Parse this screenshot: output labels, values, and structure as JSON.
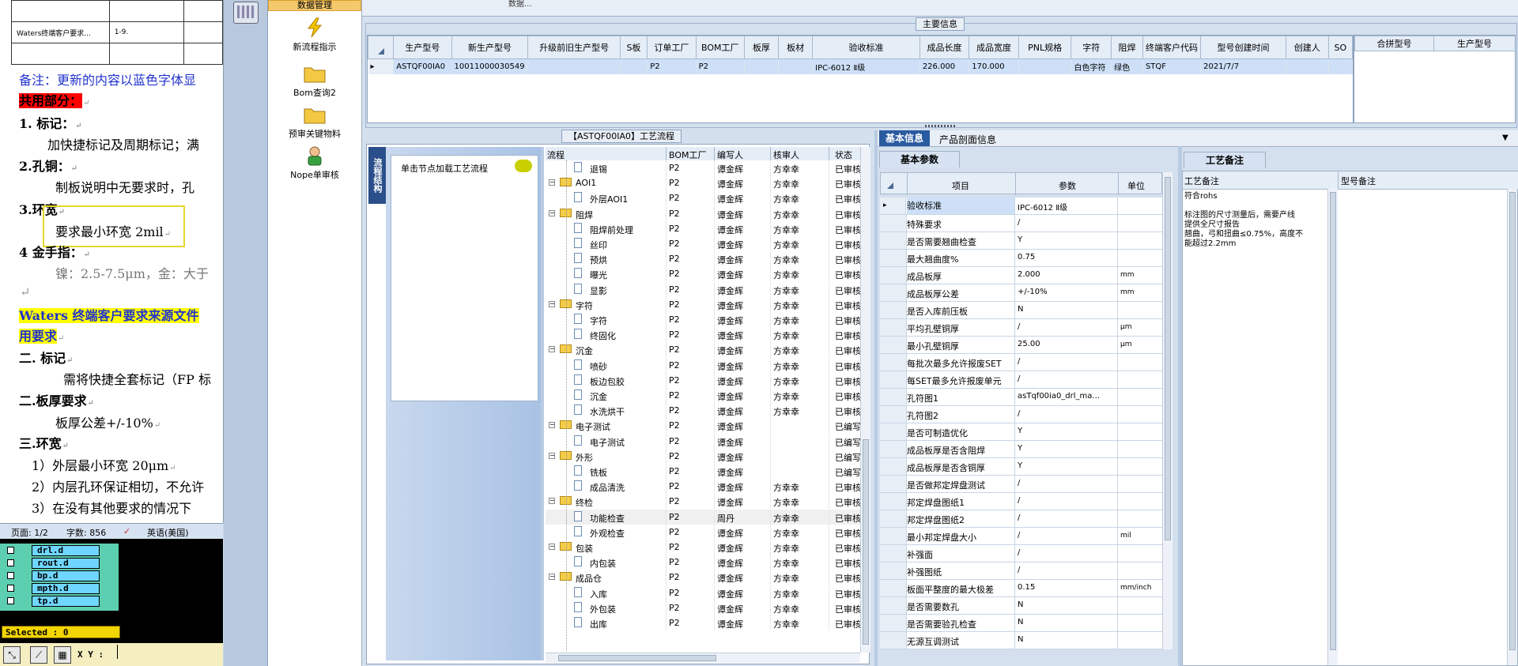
{
  "word": {
    "table_rows": [
      {
        "c1": "",
        "c2": "",
        "c3": ""
      },
      {
        "c1": "Waters终端客户要求...",
        "c2": "1-9.",
        "c3": ""
      },
      {
        "c1": "",
        "c2": "",
        "c3": ""
      }
    ],
    "lines": {
      "note": "备注：更新的内容以蓝色字体显",
      "common": "共用部分：",
      "h1": "1.    标记：",
      "p1": "加快捷标记及周期标记；满",
      "h2": "2.孔铜：",
      "p2": "制板说明中无要求时，孔",
      "h3": "3.环宽",
      "p3": "要求最小环宽 2mil",
      "h4": "4  金手指：",
      "p4": "镍：2.5-7.5μm，金：大于",
      "waters1": "Waters 终端客户要求来源文件",
      "waters2": "用要求",
      "h5": "二.  标记",
      "p5": "需将快捷全套标记（FP 标",
      "h6": "二.板厚要求",
      "p6": "板厚公差+/-10%",
      "h7": "三.环宽",
      "p7": "1）外层最小环宽 20μm",
      "p8": "2）内层孔环保证相切，不允许",
      "p9": "3）在没有其他要求的情况下"
    },
    "status": {
      "page": "页面: 1/2",
      "words": "字数: 856",
      "lang": "英语(美国)"
    }
  },
  "cam": {
    "layers": [
      "drl.d",
      "rout.d",
      "bp.d",
      "mpth.d",
      "tp.d"
    ],
    "selected": "Selected : 0",
    "xy": "X Y :"
  },
  "toolbar": {
    "data_mgmt": "数据管理",
    "items": [
      "新流程指示",
      "Bom查询2",
      "预审关键物料",
      "Nope单审核"
    ]
  },
  "main_info": {
    "title": "主要信息",
    "top_stub": "数据...",
    "headers": [
      "生产型号",
      "新生产型号",
      "升级前旧生产型号",
      "S板",
      "订单工厂",
      "BOM工厂",
      "板厚",
      "板材",
      "验收标准",
      "成品长度",
      "成品宽度",
      "PNL规格",
      "字符",
      "阻焊",
      "终端客户代码",
      "型号创建时间",
      "创建人",
      "SO"
    ],
    "row": [
      "ASTQF00IA0",
      "10011000030549",
      "",
      "",
      "P2",
      "P2",
      "",
      "",
      "IPC-6012 Ⅱ级",
      "226.000",
      "170.000",
      "",
      "白色字符",
      "绿色",
      "STQF",
      "2021/7/7",
      "",
      ""
    ],
    "merge_headers": [
      "合拼型号",
      "生产型号"
    ]
  },
  "process": {
    "title": "【ASTQF00IA0】工艺流程",
    "side_tab": "流程结构",
    "load_text": "单击节点加载工艺流程",
    "headers": [
      "流程",
      "BOM工厂",
      "编写人",
      "核审人",
      "状态"
    ],
    "rows": [
      {
        "name": "退锡",
        "level": 2,
        "type": "doc",
        "bom": "P2",
        "writer": "谭金辉",
        "reviewer": "方幸幸",
        "status": "已审核"
      },
      {
        "name": "AOI1",
        "level": 1,
        "type": "folder",
        "bom": "P2",
        "writer": "谭金辉",
        "reviewer": "方幸幸",
        "status": "已审核"
      },
      {
        "name": "外层AOI1",
        "level": 2,
        "type": "doc",
        "bom": "P2",
        "writer": "谭金辉",
        "reviewer": "方幸幸",
        "status": "已审核"
      },
      {
        "name": "阻焊",
        "level": 1,
        "type": "folder",
        "bom": "P2",
        "writer": "谭金辉",
        "reviewer": "方幸幸",
        "status": "已审核"
      },
      {
        "name": "阻焊前处理",
        "level": 2,
        "type": "doc",
        "bom": "P2",
        "writer": "谭金辉",
        "reviewer": "方幸幸",
        "status": "已审核"
      },
      {
        "name": "丝印",
        "level": 2,
        "type": "doc",
        "bom": "P2",
        "writer": "谭金辉",
        "reviewer": "方幸幸",
        "status": "已审核"
      },
      {
        "name": "预烘",
        "level": 2,
        "type": "doc",
        "bom": "P2",
        "writer": "谭金辉",
        "reviewer": "方幸幸",
        "status": "已审核"
      },
      {
        "name": "曝光",
        "level": 2,
        "type": "doc",
        "bom": "P2",
        "writer": "谭金辉",
        "reviewer": "方幸幸",
        "status": "已审核"
      },
      {
        "name": "显影",
        "level": 2,
        "type": "doc",
        "bom": "P2",
        "writer": "谭金辉",
        "reviewer": "方幸幸",
        "status": "已审核"
      },
      {
        "name": "字符",
        "level": 1,
        "type": "folder",
        "bom": "P2",
        "writer": "谭金辉",
        "reviewer": "方幸幸",
        "status": "已审核"
      },
      {
        "name": "字符",
        "level": 2,
        "type": "doc",
        "bom": "P2",
        "writer": "谭金辉",
        "reviewer": "方幸幸",
        "status": "已审核"
      },
      {
        "name": "终固化",
        "level": 2,
        "type": "doc",
        "bom": "P2",
        "writer": "谭金辉",
        "reviewer": "方幸幸",
        "status": "已审核"
      },
      {
        "name": "沉金",
        "level": 1,
        "type": "folder",
        "bom": "P2",
        "writer": "谭金辉",
        "reviewer": "方幸幸",
        "status": "已审核"
      },
      {
        "name": "喷砂",
        "level": 2,
        "type": "doc",
        "bom": "P2",
        "writer": "谭金辉",
        "reviewer": "方幸幸",
        "status": "已审核"
      },
      {
        "name": "板边包胶",
        "level": 2,
        "type": "doc",
        "bom": "P2",
        "writer": "谭金辉",
        "reviewer": "方幸幸",
        "status": "已审核"
      },
      {
        "name": "沉金",
        "level": 2,
        "type": "doc",
        "bom": "P2",
        "writer": "谭金辉",
        "reviewer": "方幸幸",
        "status": "已审核"
      },
      {
        "name": "水洗烘干",
        "level": 2,
        "type": "doc",
        "bom": "P2",
        "writer": "谭金辉",
        "reviewer": "方幸幸",
        "status": "已审核"
      },
      {
        "name": "电子测试",
        "level": 1,
        "type": "folder",
        "bom": "P2",
        "writer": "谭金辉",
        "reviewer": "",
        "status": "已编写"
      },
      {
        "name": "电子测试",
        "level": 2,
        "type": "doc",
        "bom": "P2",
        "writer": "谭金辉",
        "reviewer": "",
        "status": "已编写"
      },
      {
        "name": "外形",
        "level": 1,
        "type": "folder",
        "bom": "P2",
        "writer": "谭金辉",
        "reviewer": "",
        "status": "已编写"
      },
      {
        "name": "铣板",
        "level": 2,
        "type": "doc",
        "bom": "P2",
        "writer": "谭金辉",
        "reviewer": "",
        "status": "已编写"
      },
      {
        "name": "成品清洗",
        "level": 2,
        "type": "doc",
        "bom": "P2",
        "writer": "谭金辉",
        "reviewer": "方幸幸",
        "status": "已审核"
      },
      {
        "name": "终检",
        "level": 1,
        "type": "folder",
        "bom": "P2",
        "writer": "谭金辉",
        "reviewer": "方幸幸",
        "status": "已审核"
      },
      {
        "name": "功能检查",
        "level": 2,
        "type": "doc",
        "bom": "P2",
        "writer": "周丹",
        "reviewer": "方幸幸",
        "status": "已审核"
      },
      {
        "name": "外观检查",
        "level": 2,
        "type": "doc",
        "bom": "P2",
        "writer": "谭金辉",
        "reviewer": "方幸幸",
        "status": "已审核"
      },
      {
        "name": "包装",
        "level": 1,
        "type": "folder",
        "bom": "P2",
        "writer": "谭金辉",
        "reviewer": "方幸幸",
        "status": "已审核"
      },
      {
        "name": "内包装",
        "level": 2,
        "type": "doc",
        "bom": "P2",
        "writer": "谭金辉",
        "reviewer": "方幸幸",
        "status": "已审核"
      },
      {
        "name": "成品仓",
        "level": 1,
        "type": "folder",
        "bom": "P2",
        "writer": "谭金辉",
        "reviewer": "方幸幸",
        "status": "已审核"
      },
      {
        "name": "入库",
        "level": 2,
        "type": "doc",
        "bom": "P2",
        "writer": "谭金辉",
        "reviewer": "方幸幸",
        "status": "已审核"
      },
      {
        "name": "外包装",
        "level": 2,
        "type": "doc",
        "bom": "P2",
        "writer": "谭金辉",
        "reviewer": "方幸幸",
        "status": "已审核"
      },
      {
        "name": "出库",
        "level": 2,
        "type": "doc",
        "bom": "P2",
        "writer": "谭金辉",
        "reviewer": "方幸幸",
        "status": "已审核"
      }
    ]
  },
  "basic": {
    "tab1": "基本信息",
    "tab2": "产品剖面信息",
    "subtab": "基本参数",
    "headers": [
      "项目",
      "参数",
      "单位"
    ],
    "rows": [
      [
        "验收标准",
        "IPC-6012 Ⅱ级",
        ""
      ],
      [
        "特殊要求",
        "/",
        ""
      ],
      [
        "是否需要翘曲检查",
        "Y",
        ""
      ],
      [
        "最大翘曲度%",
        "0.75",
        ""
      ],
      [
        "成品板厚",
        "2.000",
        "mm"
      ],
      [
        "成品板厚公差",
        "+/-10%",
        "mm"
      ],
      [
        "是否入库前压板",
        "N",
        ""
      ],
      [
        "平均孔壁铜厚",
        "/",
        "μm"
      ],
      [
        "最小孔壁铜厚",
        "25.00",
        "μm"
      ],
      [
        "每批次最多允许报废SET",
        "/",
        ""
      ],
      [
        "每SET最多允许报废单元",
        "/",
        ""
      ],
      [
        "孔符图1",
        "asTqf00ia0_drl_ma...",
        ""
      ],
      [
        "孔符图2",
        "/",
        ""
      ],
      [
        "是否可制造优化",
        "Y",
        ""
      ],
      [
        "成品板厚是否含阻焊",
        "Y",
        ""
      ],
      [
        "成品板厚是否含铜厚",
        "Y",
        ""
      ],
      [
        "是否做邦定焊盘测试",
        "/",
        ""
      ],
      [
        "邦定焊盘图纸1",
        "/",
        ""
      ],
      [
        "邦定焊盘图纸2",
        "/",
        ""
      ],
      [
        "最小邦定焊盘大小",
        "/",
        "mil"
      ],
      [
        "补强面",
        "/",
        ""
      ],
      [
        "补强图纸",
        "/",
        ""
      ],
      [
        "板面平整度的最大极差",
        "0.15",
        "mm/inch"
      ],
      [
        "是否需要数孔",
        "N",
        ""
      ],
      [
        "是否需要验孔检查",
        "N",
        ""
      ],
      [
        "无源互调测试",
        "N",
        ""
      ]
    ]
  },
  "notes": {
    "tab": "工艺备注",
    "col1": "工艺备注",
    "col2": "型号备注",
    "text": [
      "符合rohs",
      "",
      "标注图的尺寸测量后，需要产线",
      "提供全尺寸报告",
      "翘曲，弓和扭曲≤0.75%，高度不",
      "能超过2.2mm"
    ]
  }
}
